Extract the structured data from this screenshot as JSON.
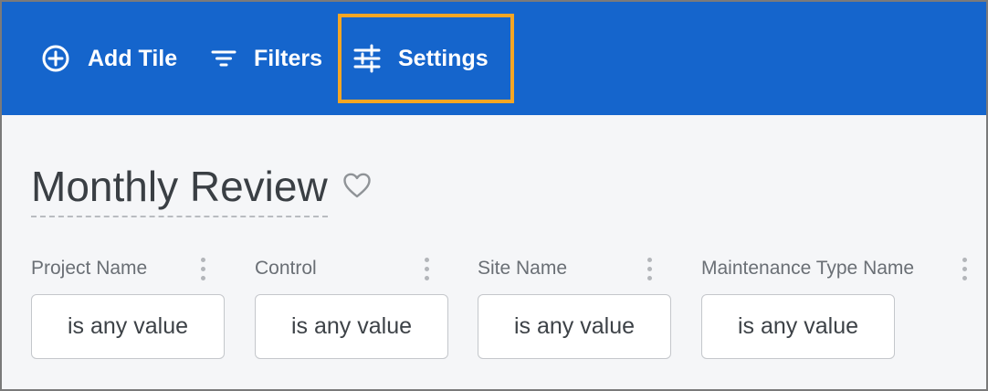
{
  "toolbar": {
    "add_tile_label": "Add Tile",
    "filters_label": "Filters",
    "settings_label": "Settings",
    "background_color": "#1565cc",
    "highlight_color": "#f5a623"
  },
  "dashboard": {
    "title": "Monthly Review"
  },
  "filters": [
    {
      "label": "Project Name",
      "value": "is any value"
    },
    {
      "label": "Control",
      "value": "is any value"
    },
    {
      "label": "Site Name",
      "value": "is any value"
    },
    {
      "label": "Maintenance Type Name",
      "value": "is any value"
    }
  ]
}
